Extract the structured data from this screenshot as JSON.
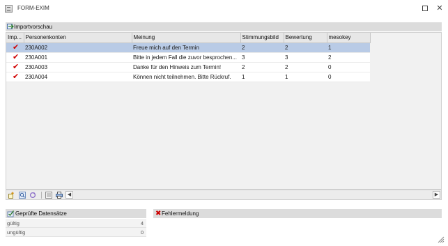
{
  "window": {
    "title": "FORM-EXIM"
  },
  "import_panel": {
    "title": "Importvorschau",
    "columns": [
      "Imp...",
      "Personenkonten",
      "Meinung",
      "Stimmungsbild",
      "Bewertung",
      "mesokey"
    ],
    "rows": [
      {
        "imported": true,
        "account": "230A002",
        "opinion": "Freue mich auf den Termin",
        "mood": "2",
        "rating": "2",
        "mesokey": "1",
        "selected": true
      },
      {
        "imported": true,
        "account": "230A001",
        "opinion": "Bitte in jedem Fall die zuvor besprochen...",
        "mood": "3",
        "rating": "3",
        "mesokey": "2",
        "selected": false
      },
      {
        "imported": true,
        "account": "230A003",
        "opinion": "Danke für den Hinweis zum Termin!",
        "mood": "2",
        "rating": "2",
        "mesokey": "0",
        "selected": false
      },
      {
        "imported": true,
        "account": "230A004",
        "opinion": "Können nicht teilnehmen. Bitte Rückruf.",
        "mood": "1",
        "rating": "1",
        "mesokey": "0",
        "selected": false
      }
    ]
  },
  "toolbar": {
    "icons": [
      "insert-row-icon",
      "search-icon",
      "refresh-icon",
      "list-icon",
      "print-icon"
    ]
  },
  "checked_panel": {
    "title": "Geprüfte Datensätze",
    "valid_label": "gültig",
    "valid_count": "4",
    "invalid_label": "ungültig",
    "invalid_count": "0"
  },
  "error_panel": {
    "title": "Fehlermeldung"
  },
  "colors": {
    "selected_row": "#b9cbe6",
    "checkmark": "#d00000",
    "header_bg": "#dcdcdc"
  }
}
